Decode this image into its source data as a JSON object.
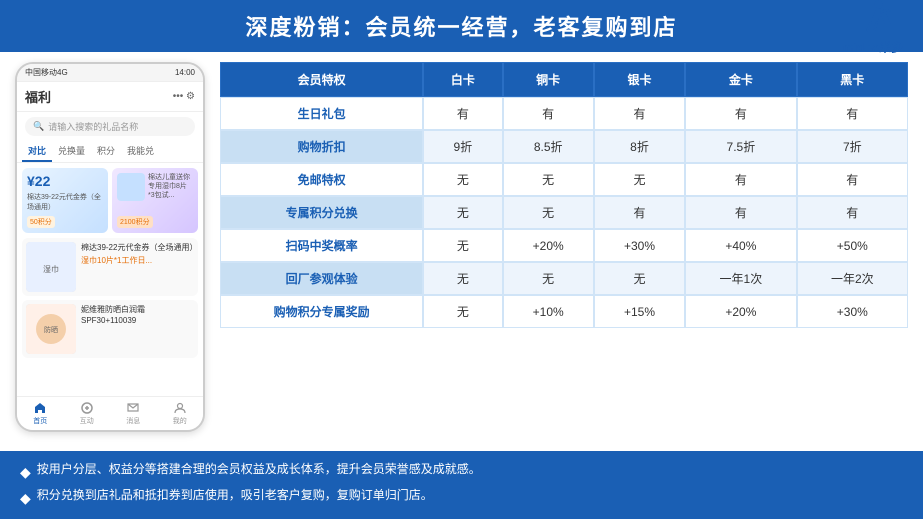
{
  "header": {
    "title": "深度粉销：会员统一经营，老客复购到店",
    "logo_text": "midoo米多"
  },
  "phone": {
    "status_bar": "中国移动4G",
    "time": "14:00",
    "section_title": "福利",
    "search_placeholder": "请输入搜索的礼品名称",
    "tabs": [
      "对比",
      "兑换量",
      "积分",
      "我能兑"
    ],
    "active_tab": "对比",
    "coupon1_price": "¥22",
    "coupon1_desc": "棉达39-22元代金券（全场通用）",
    "coupon1_points": "50积分",
    "coupon2_desc": "棉达儿童送你专用湿巾8片*3包试...",
    "coupon2_points": "2100积分",
    "product1_name": "棉达39-22元代金券（全场通用）",
    "product1_desc": "湿巾10片*1工作日...",
    "product2_name": "妮维雅防晒白润霜\nSPF30+110039",
    "nav_items": [
      "首页",
      "互动",
      "消息",
      "我的"
    ]
  },
  "table": {
    "headers": [
      "会员特权",
      "白卡",
      "铜卡",
      "银卡",
      "金卡",
      "黑卡"
    ],
    "rows": [
      [
        "生日礼包",
        "有",
        "有",
        "有",
        "有",
        "有"
      ],
      [
        "购物折扣",
        "9折",
        "8.5折",
        "8折",
        "7.5折",
        "7折"
      ],
      [
        "免邮特权",
        "无",
        "无",
        "无",
        "有",
        "有"
      ],
      [
        "专属积分兑换",
        "无",
        "无",
        "有",
        "有",
        "有"
      ],
      [
        "扫码中奖概率",
        "无",
        "+20%",
        "+30%",
        "+40%",
        "+50%"
      ],
      [
        "回厂参观体验",
        "无",
        "无",
        "无",
        "一年1次",
        "一年2次"
      ],
      [
        "购物积分专属奖励",
        "无",
        "+10%",
        "+15%",
        "+20%",
        "+30%"
      ]
    ]
  },
  "footer": {
    "items": [
      "按用户分层、权益分等搭建合理的会员权益及成长体系，提升会员荣誉感及成就感。",
      "积分兑换到店礼品和抵扣券到店使用，吸引老客户复购，复购订单归门店。"
    ]
  }
}
